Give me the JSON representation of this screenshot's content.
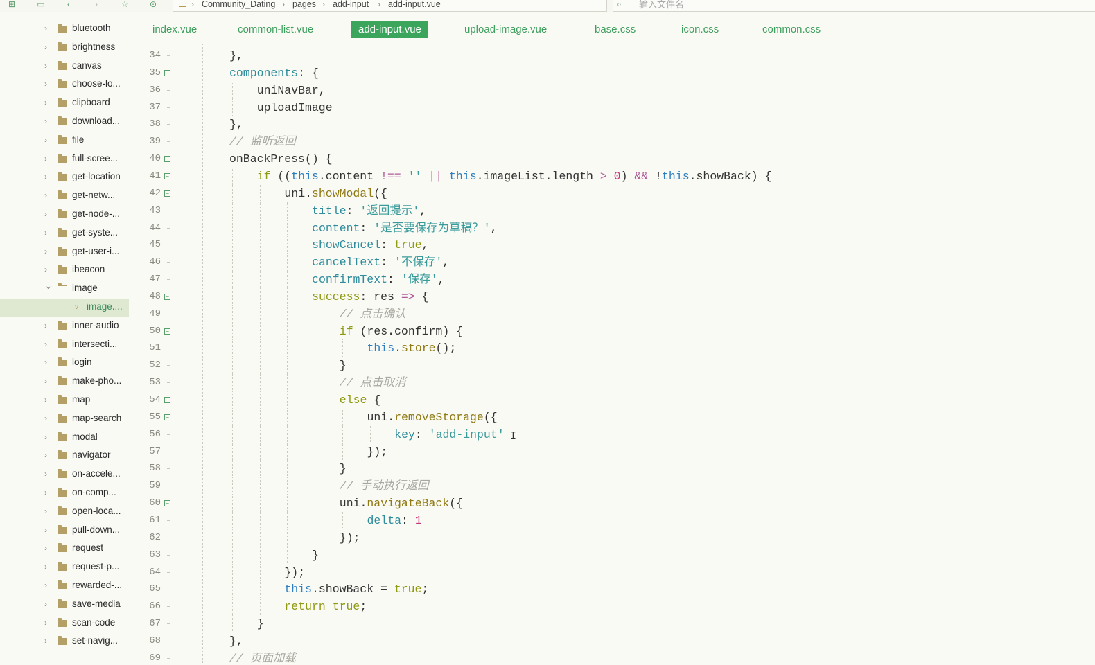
{
  "toolbar": {
    "breadcrumb": [
      "Community_Dating",
      "pages",
      "add-input",
      "add-input.vue"
    ],
    "search_placeholder": "输入文件名",
    "icons": [
      "new-file-icon",
      "save-icon",
      "back-icon",
      "forward-icon",
      "star-icon",
      "run-icon"
    ]
  },
  "sidebar": {
    "items": [
      {
        "label": "bluetooth",
        "type": "folder"
      },
      {
        "label": "brightness",
        "type": "folder"
      },
      {
        "label": "canvas",
        "type": "folder"
      },
      {
        "label": "choose-lo...",
        "type": "folder"
      },
      {
        "label": "clipboard",
        "type": "folder"
      },
      {
        "label": "download...",
        "type": "folder"
      },
      {
        "label": "file",
        "type": "folder"
      },
      {
        "label": "full-scree...",
        "type": "folder"
      },
      {
        "label": "get-location",
        "type": "folder"
      },
      {
        "label": "get-netw...",
        "type": "folder"
      },
      {
        "label": "get-node-...",
        "type": "folder"
      },
      {
        "label": "get-syste...",
        "type": "folder"
      },
      {
        "label": "get-user-i...",
        "type": "folder"
      },
      {
        "label": "ibeacon",
        "type": "folder"
      },
      {
        "label": "image",
        "type": "folder-open"
      },
      {
        "label": "image....",
        "type": "file"
      },
      {
        "label": "inner-audio",
        "type": "folder"
      },
      {
        "label": "intersecti...",
        "type": "folder"
      },
      {
        "label": "login",
        "type": "folder"
      },
      {
        "label": "make-pho...",
        "type": "folder"
      },
      {
        "label": "map",
        "type": "folder"
      },
      {
        "label": "map-search",
        "type": "folder"
      },
      {
        "label": "modal",
        "type": "folder"
      },
      {
        "label": "navigator",
        "type": "folder"
      },
      {
        "label": "on-accele...",
        "type": "folder"
      },
      {
        "label": "on-comp...",
        "type": "folder"
      },
      {
        "label": "open-loca...",
        "type": "folder"
      },
      {
        "label": "pull-down...",
        "type": "folder"
      },
      {
        "label": "request",
        "type": "folder"
      },
      {
        "label": "request-p...",
        "type": "folder"
      },
      {
        "label": "rewarded-...",
        "type": "folder"
      },
      {
        "label": "save-media",
        "type": "folder"
      },
      {
        "label": "scan-code",
        "type": "folder"
      },
      {
        "label": "set-navig...",
        "type": "folder"
      }
    ]
  },
  "tabs": [
    {
      "label": "index.vue",
      "active": false
    },
    {
      "label": "common-list.vue",
      "active": false
    },
    {
      "label": "add-input.vue",
      "active": true
    },
    {
      "label": "upload-image.vue",
      "active": false
    },
    {
      "label": "base.css",
      "active": false
    },
    {
      "label": "icon.css",
      "active": false
    },
    {
      "label": "common.css",
      "active": false
    }
  ],
  "code": {
    "lines": [
      {
        "n": "34",
        "fold": false,
        "indent": 2,
        "tokens": [
          [
            "pl",
            "},"
          ]
        ]
      },
      {
        "n": "35",
        "fold": true,
        "indent": 2,
        "tokens": [
          [
            "prop",
            "components"
          ],
          [
            "pl",
            ": {"
          ]
        ]
      },
      {
        "n": "36",
        "fold": false,
        "indent": 3,
        "tokens": [
          [
            "pl",
            "uniNavBar,"
          ]
        ]
      },
      {
        "n": "37",
        "fold": false,
        "indent": 3,
        "tokens": [
          [
            "pl",
            "uploadImage"
          ]
        ]
      },
      {
        "n": "38",
        "fold": false,
        "indent": 2,
        "tokens": [
          [
            "pl",
            "},"
          ]
        ]
      },
      {
        "n": "39",
        "fold": false,
        "indent": 2,
        "tokens": [
          [
            "cmt",
            "// 监听返回"
          ]
        ]
      },
      {
        "n": "40",
        "fold": true,
        "indent": 2,
        "tokens": [
          [
            "pl",
            "onBackPress() {"
          ]
        ]
      },
      {
        "n": "41",
        "fold": true,
        "indent": 3,
        "tokens": [
          [
            "kw",
            "if"
          ],
          [
            "pl",
            " (("
          ],
          [
            "this",
            "this"
          ],
          [
            "pl",
            ".content "
          ],
          [
            "op",
            "!=="
          ],
          [
            "pl",
            " "
          ],
          [
            "str",
            "''"
          ],
          [
            "pl",
            " "
          ],
          [
            "op",
            "||"
          ],
          [
            "pl",
            " "
          ],
          [
            "this",
            "this"
          ],
          [
            "pl",
            ".imageList.length "
          ],
          [
            "op",
            ">"
          ],
          [
            "pl",
            " "
          ],
          [
            "num",
            "0"
          ],
          [
            "pl",
            ") "
          ],
          [
            "op",
            "&&"
          ],
          [
            "pl",
            " !"
          ],
          [
            "this",
            "this"
          ],
          [
            "pl",
            ".showBack) {"
          ]
        ]
      },
      {
        "n": "42",
        "fold": true,
        "indent": 4,
        "tokens": [
          [
            "pl",
            "uni."
          ],
          [
            "fn",
            "showModal"
          ],
          [
            "pl",
            "({"
          ]
        ]
      },
      {
        "n": "43",
        "fold": false,
        "indent": 5,
        "tokens": [
          [
            "prop",
            "title"
          ],
          [
            "pl",
            ": "
          ],
          [
            "str",
            "'返回提示'"
          ],
          [
            "pl",
            ","
          ]
        ]
      },
      {
        "n": "44",
        "fold": false,
        "indent": 5,
        "tokens": [
          [
            "prop",
            "content"
          ],
          [
            "pl",
            ": "
          ],
          [
            "str",
            "'是否要保存为草稿？'"
          ],
          [
            "pl",
            ","
          ]
        ]
      },
      {
        "n": "45",
        "fold": false,
        "indent": 5,
        "tokens": [
          [
            "prop",
            "showCancel"
          ],
          [
            "pl",
            ": "
          ],
          [
            "kw",
            "true"
          ],
          [
            "pl",
            ","
          ]
        ]
      },
      {
        "n": "46",
        "fold": false,
        "indent": 5,
        "tokens": [
          [
            "prop",
            "cancelText"
          ],
          [
            "pl",
            ": "
          ],
          [
            "str",
            "'不保存'"
          ],
          [
            "pl",
            ","
          ]
        ]
      },
      {
        "n": "47",
        "fold": false,
        "indent": 5,
        "tokens": [
          [
            "prop",
            "confirmText"
          ],
          [
            "pl",
            ": "
          ],
          [
            "str",
            "'保存'"
          ],
          [
            "pl",
            ","
          ]
        ]
      },
      {
        "n": "48",
        "fold": true,
        "indent": 5,
        "tokens": [
          [
            "kw",
            "success"
          ],
          [
            "pl",
            ": res "
          ],
          [
            "op",
            "=>"
          ],
          [
            "pl",
            " {"
          ]
        ]
      },
      {
        "n": "49",
        "fold": false,
        "indent": 6,
        "tokens": [
          [
            "cmt",
            "// 点击确认"
          ]
        ]
      },
      {
        "n": "50",
        "fold": true,
        "indent": 6,
        "tokens": [
          [
            "kw",
            "if"
          ],
          [
            "pl",
            " (res.confirm) {"
          ]
        ]
      },
      {
        "n": "51",
        "fold": false,
        "indent": 7,
        "tokens": [
          [
            "this",
            "this"
          ],
          [
            "pl",
            "."
          ],
          [
            "fn",
            "store"
          ],
          [
            "pl",
            "();"
          ]
        ]
      },
      {
        "n": "52",
        "fold": false,
        "indent": 6,
        "tokens": [
          [
            "pl",
            "}"
          ]
        ]
      },
      {
        "n": "53",
        "fold": false,
        "indent": 6,
        "tokens": [
          [
            "cmt",
            "// 点击取消"
          ]
        ]
      },
      {
        "n": "54",
        "fold": true,
        "indent": 6,
        "tokens": [
          [
            "kw",
            "else"
          ],
          [
            "pl",
            " {"
          ]
        ]
      },
      {
        "n": "55",
        "fold": true,
        "indent": 7,
        "tokens": [
          [
            "pl",
            "uni."
          ],
          [
            "fn",
            "removeStorage"
          ],
          [
            "pl",
            "({"
          ]
        ]
      },
      {
        "n": "56",
        "fold": false,
        "indent": 8,
        "tokens": [
          [
            "prop",
            "key"
          ],
          [
            "pl",
            ": "
          ],
          [
            "str",
            "'add-input'"
          ]
        ]
      },
      {
        "n": "57",
        "fold": false,
        "indent": 7,
        "tokens": [
          [
            "pl",
            "});"
          ]
        ]
      },
      {
        "n": "58",
        "fold": false,
        "indent": 6,
        "tokens": [
          [
            "pl",
            "}"
          ]
        ]
      },
      {
        "n": "59",
        "fold": false,
        "indent": 6,
        "tokens": [
          [
            "cmt",
            "// 手动执行返回"
          ]
        ]
      },
      {
        "n": "60",
        "fold": true,
        "indent": 6,
        "tokens": [
          [
            "pl",
            "uni."
          ],
          [
            "fn",
            "navigateBack"
          ],
          [
            "pl",
            "({"
          ]
        ]
      },
      {
        "n": "61",
        "fold": false,
        "indent": 7,
        "tokens": [
          [
            "prop",
            "delta"
          ],
          [
            "pl",
            ": "
          ],
          [
            "num",
            "1"
          ]
        ]
      },
      {
        "n": "62",
        "fold": false,
        "indent": 6,
        "tokens": [
          [
            "pl",
            "});"
          ]
        ]
      },
      {
        "n": "63",
        "fold": false,
        "indent": 5,
        "tokens": [
          [
            "pl",
            "}"
          ]
        ]
      },
      {
        "n": "64",
        "fold": false,
        "indent": 4,
        "tokens": [
          [
            "pl",
            "});"
          ]
        ]
      },
      {
        "n": "65",
        "fold": false,
        "indent": 4,
        "tokens": [
          [
            "this",
            "this"
          ],
          [
            "pl",
            ".showBack = "
          ],
          [
            "kw",
            "true"
          ],
          [
            "pl",
            ";"
          ]
        ]
      },
      {
        "n": "66",
        "fold": false,
        "indent": 4,
        "tokens": [
          [
            "kw",
            "return"
          ],
          [
            "pl",
            " "
          ],
          [
            "kw",
            "true"
          ],
          [
            "pl",
            ";"
          ]
        ]
      },
      {
        "n": "67",
        "fold": false,
        "indent": 3,
        "tokens": [
          [
            "pl",
            "}"
          ]
        ]
      },
      {
        "n": "68",
        "fold": false,
        "indent": 2,
        "tokens": [
          [
            "pl",
            "},"
          ]
        ]
      },
      {
        "n": "69",
        "fold": false,
        "indent": 2,
        "tokens": [
          [
            "cmt",
            "// 页面加载"
          ]
        ]
      }
    ]
  },
  "colors": {
    "accent": "#3ca55c",
    "keyword": "#8f9a13",
    "property": "#2e8c9c",
    "string": "#3a9b9b",
    "comment": "#a8a8a0",
    "this": "#2f7fc0",
    "number": "#c2367a"
  }
}
